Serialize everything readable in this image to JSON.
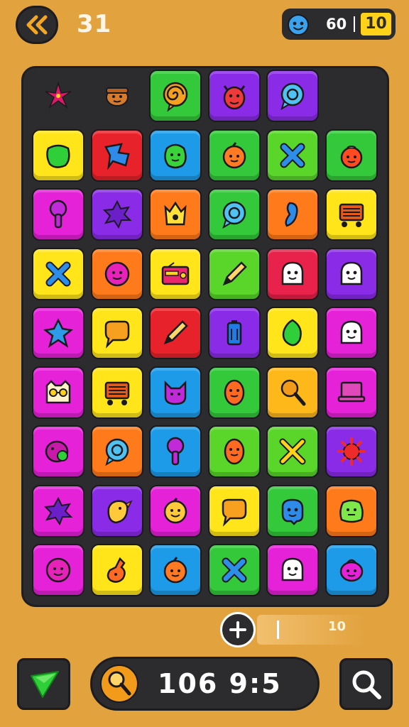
{
  "header": {
    "level": "31",
    "score": "60",
    "badge": "10"
  },
  "controls": {
    "count": "10"
  },
  "footer": {
    "score": "106 9:5"
  },
  "board": {
    "tiles": [
      {
        "color": "",
        "icon": "flower"
      },
      {
        "color": "",
        "icon": "monkey-face"
      },
      {
        "color": "#33c93a",
        "icon": "swirl-bubble"
      },
      {
        "color": "#8a2be8",
        "icon": "devil-face"
      },
      {
        "color": "#8a2be8",
        "icon": "chat-bubble"
      },
      {
        "color": "",
        "icon": "none"
      },
      {
        "color": "#ffe51a",
        "icon": "blob"
      },
      {
        "color": "#e8222a",
        "icon": "fish"
      },
      {
        "color": "#1e9be8",
        "icon": "cactus-face"
      },
      {
        "color": "#33c93a",
        "icon": "orange-face"
      },
      {
        "color": "#5ad62a",
        "icon": "cross"
      },
      {
        "color": "#33c93a",
        "icon": "tomato-face"
      },
      {
        "color": "#e622d8",
        "icon": "key"
      },
      {
        "color": "#8a2be8",
        "icon": "splat"
      },
      {
        "color": "#ff7a1a",
        "icon": "crown-face"
      },
      {
        "color": "#33c93a",
        "icon": "chat-bubble"
      },
      {
        "color": "#ff7a1a",
        "icon": "bean"
      },
      {
        "color": "#ffe51a",
        "icon": "cart"
      },
      {
        "color": "#ffe51a",
        "icon": "cross"
      },
      {
        "color": "#ff7a1a",
        "icon": "face"
      },
      {
        "color": "#ffe51a",
        "icon": "radio"
      },
      {
        "color": "#5ad62a",
        "icon": "pencil"
      },
      {
        "color": "#e8224a",
        "icon": "ghost-face"
      },
      {
        "color": "#8a2be8",
        "icon": "ghost-face"
      },
      {
        "color": "#e622d8",
        "icon": "star"
      },
      {
        "color": "#ffe51a",
        "icon": "speech"
      },
      {
        "color": "#e8222a",
        "icon": "pencil"
      },
      {
        "color": "#8a2be8",
        "icon": "battery"
      },
      {
        "color": "#ffe51a",
        "icon": "leaf"
      },
      {
        "color": "#e622d8",
        "icon": "ghost-face"
      },
      {
        "color": "#e622d8",
        "icon": "glasses-face"
      },
      {
        "color": "#ffe51a",
        "icon": "cart"
      },
      {
        "color": "#1e9be8",
        "icon": "cat-face"
      },
      {
        "color": "#33c93a",
        "icon": "bean-face"
      },
      {
        "color": "#ffb81a",
        "icon": "magnifier"
      },
      {
        "color": "#e622d8",
        "icon": "laptop"
      },
      {
        "color": "#e622d8",
        "icon": "pig"
      },
      {
        "color": "#ff7a1a",
        "icon": "chat-bubble"
      },
      {
        "color": "#1e9be8",
        "icon": "key"
      },
      {
        "color": "#5ad62a",
        "icon": "bean-face"
      },
      {
        "color": "#5ad62a",
        "icon": "crossed-tools"
      },
      {
        "color": "#8a2be8",
        "icon": "virus"
      },
      {
        "color": "#e622d8",
        "icon": "splat"
      },
      {
        "color": "#8a2be8",
        "icon": "bird"
      },
      {
        "color": "#e622d8",
        "icon": "smiley"
      },
      {
        "color": "#ffe51a",
        "icon": "speech"
      },
      {
        "color": "#33c93a",
        "icon": "parrot-face"
      },
      {
        "color": "#ff7a1a",
        "icon": "blob-face"
      },
      {
        "color": "#e622d8",
        "icon": "face"
      },
      {
        "color": "#ffe51a",
        "icon": "fox"
      },
      {
        "color": "#1e9be8",
        "icon": "orange-face"
      },
      {
        "color": "#33c93a",
        "icon": "cross"
      },
      {
        "color": "#e622d8",
        "icon": "ghost-face"
      },
      {
        "color": "#1e9be8",
        "icon": "pot-face"
      }
    ]
  }
}
